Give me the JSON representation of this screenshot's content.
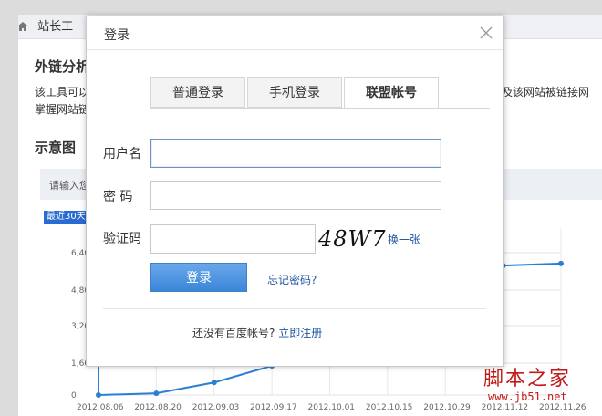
{
  "background": {
    "breadcrumb": "站长工",
    "section_title": "外链分析",
    "desc_line1": "该工具可以",
    "desc_line2": "掌握网站链",
    "desc_right": "息及该网站被链接网",
    "chart_section": "示意图",
    "search_placeholder": "请输入您",
    "range_tag": "最近30天",
    "y_ticks": [
      "6,40",
      "4,80",
      "3,20",
      "1,60",
      "0"
    ],
    "x_ticks": [
      "2012.08.06",
      "2012.08.20",
      "2012.09.03",
      "2012.09.17",
      "2012.10.01",
      "2012.10.15",
      "2012.10.29",
      "2012.11.12",
      "2012.11.26"
    ]
  },
  "chart_data": {
    "type": "line",
    "x": [
      "2012.08.06",
      "2012.08.20",
      "2012.09.03",
      "2012.09.17",
      "2012.10.01",
      "2012.10.15",
      "2012.10.29",
      "2012.11.12",
      "2012.11.26"
    ],
    "series": [
      {
        "values": [
          0,
          80,
          600,
          1400,
          2600,
          3600,
          4800,
          6200,
          6300
        ]
      }
    ],
    "ylim": [
      0,
      8000
    ]
  },
  "modal": {
    "title": "登录",
    "tabs": [
      "普通登录",
      "手机登录",
      "联盟帐号"
    ],
    "active_tab": 2,
    "username_label": "用户名",
    "password_label": "密 码",
    "captcha_label": "验证码",
    "captcha_text": "48W7",
    "refresh_captcha": "换一张",
    "login_button": "登录",
    "forgot_password": "忘记密码?",
    "register_prompt": "还没有百度帐号?",
    "register_link": "立即注册"
  },
  "watermark": {
    "site": "脚本之家",
    "url": "www.jb51.net"
  },
  "colors": {
    "accent": "#3b86d9",
    "link": "#1f55a3",
    "chart_line": "#2a7fd4"
  }
}
